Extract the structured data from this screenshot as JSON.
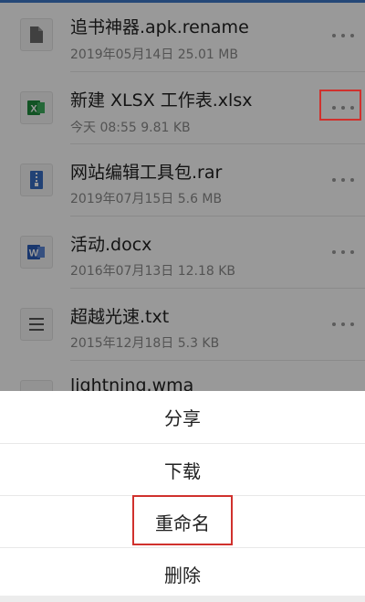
{
  "files": [
    {
      "name": "追书神器.apk.rename",
      "meta": "2019年05月14日 25.01 MB",
      "icon": "generic-file-icon",
      "icon_color": "#6b6b6b"
    },
    {
      "name": "新建 XLSX 工作表.xlsx",
      "meta": "今天 08:55 9.81 KB",
      "icon": "excel-icon",
      "icon_color": "#1f8a3c"
    },
    {
      "name": "网站编辑工具包.rar",
      "meta": "2019年07月15日 5.6 MB",
      "icon": "archive-icon",
      "icon_color": "#3a6fc4"
    },
    {
      "name": "活动.docx",
      "meta": "2016年07月13日 12.18 KB",
      "icon": "word-icon",
      "icon_color": "#2b5cb8"
    },
    {
      "name": "超越光速.txt",
      "meta": "2015年12月18日 5.3 KB",
      "icon": "text-file-icon",
      "icon_color": "#555555"
    },
    {
      "name": "lightning.wma",
      "meta": "",
      "icon": "audio-icon",
      "icon_color": "#777777"
    }
  ],
  "sheet": {
    "share": "分享",
    "download": "下载",
    "rename": "重命名",
    "delete": "删除"
  },
  "colors": {
    "highlight": "#d0312d",
    "accent": "#3f79c9"
  }
}
